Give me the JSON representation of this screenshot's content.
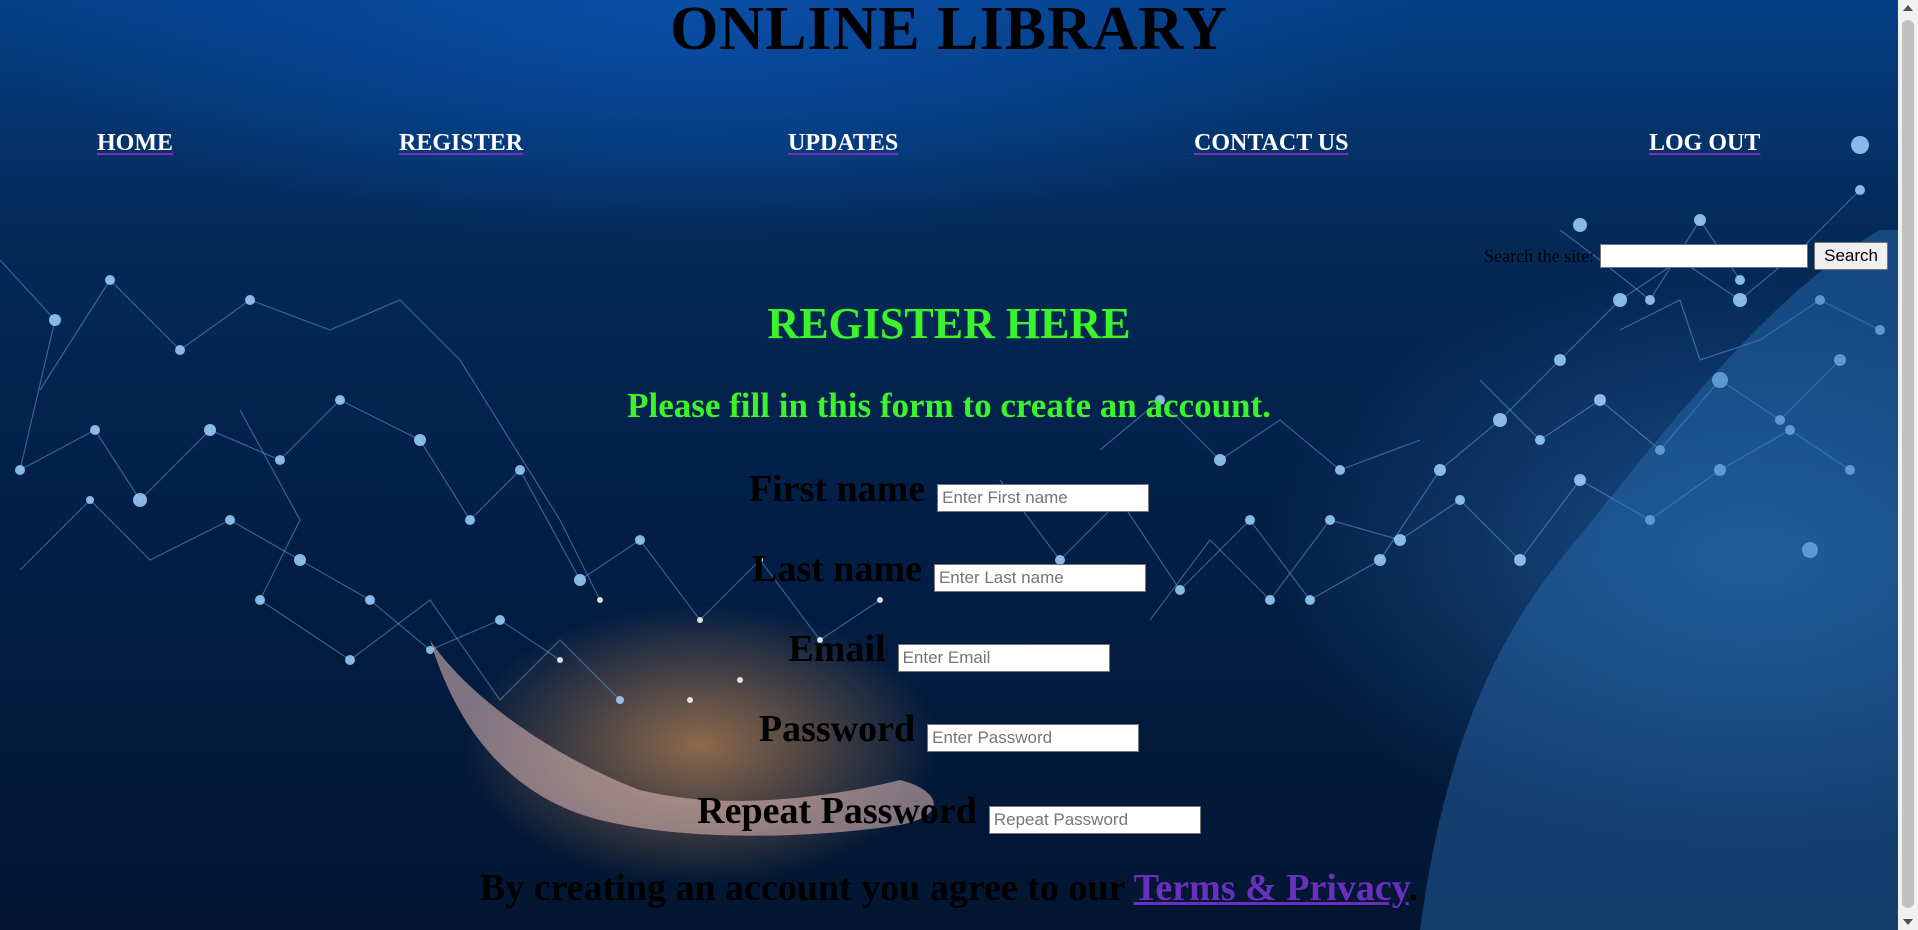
{
  "site": {
    "title": "ONLINE LIBRARY"
  },
  "nav": {
    "home": "HOME",
    "register": "REGISTER",
    "updates": "UPDATES",
    "contact": "CONTACT US",
    "logout": "LOG OUT"
  },
  "search": {
    "label": "Search the site:",
    "value": "",
    "button": "Search"
  },
  "form": {
    "heading": "REGISTER HERE",
    "subheading": "Please fill in this form to create an account.",
    "fields": [
      {
        "label": "First name",
        "placeholder": "Enter First name",
        "value": ""
      },
      {
        "label": "Last name",
        "placeholder": "Enter Last name",
        "value": ""
      },
      {
        "label": "Email",
        "placeholder": "Enter Email",
        "value": ""
      },
      {
        "label": "Password",
        "placeholder": "Enter Password",
        "value": ""
      },
      {
        "label": "Repeat Password",
        "placeholder": "Repeat Password",
        "value": ""
      }
    ],
    "agree_text": "By creating an account you agree to our ",
    "terms_link": "Terms & Privacy",
    "agree_end": "."
  },
  "colors": {
    "heading_green": "#3cf42b",
    "link_purple": "#6a2fbf",
    "background": "#03204a"
  }
}
